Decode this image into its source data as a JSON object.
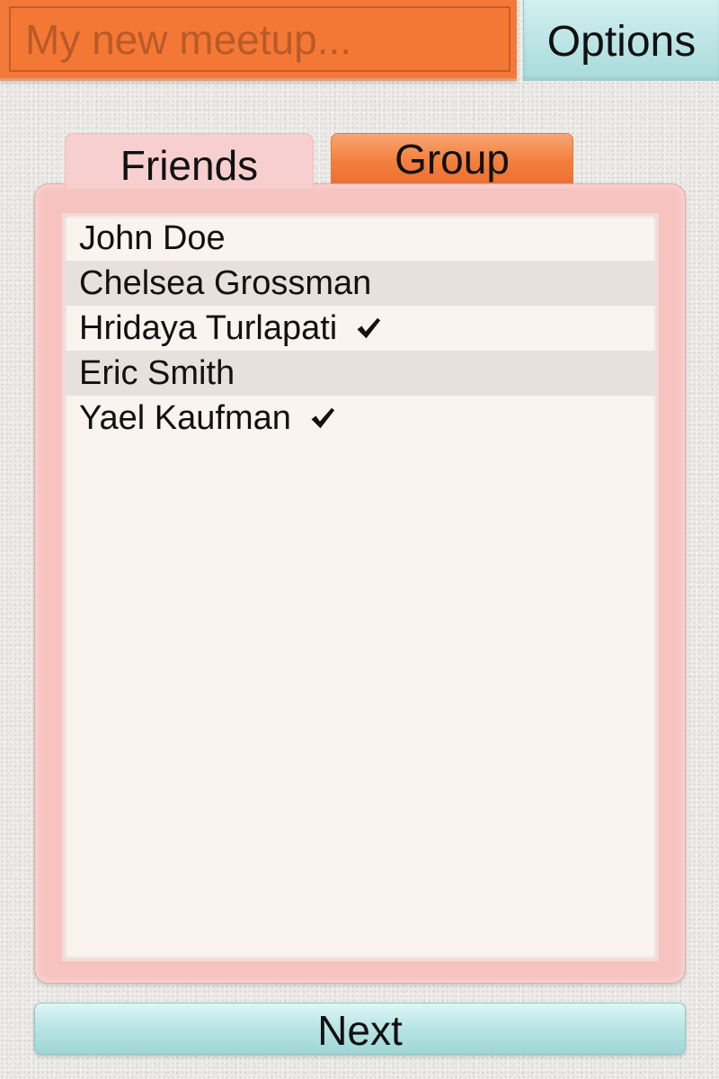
{
  "header": {
    "title_input": {
      "value": "",
      "placeholder": "My new meetup..."
    },
    "options_label": "Options"
  },
  "tabs": [
    {
      "label": "Friends",
      "selected": true
    },
    {
      "label": "Group",
      "selected": false
    }
  ],
  "friends": [
    {
      "name": "John Doe",
      "checked": false
    },
    {
      "name": "Chelsea Grossman",
      "checked": false
    },
    {
      "name": "Hridaya Turlapati",
      "checked": true
    },
    {
      "name": "Eric Smith",
      "checked": false
    },
    {
      "name": "Yael Kaufman",
      "checked": true
    }
  ],
  "footer": {
    "next_label": "Next"
  },
  "colors": {
    "accent_orange": "#f3793a",
    "accent_teal": "#bfe6e6",
    "panel_pink": "#f6c3c0",
    "list_background": "#faf3ee",
    "row_alt": "#e8e0dc"
  },
  "icons": {
    "check": "check-icon"
  }
}
